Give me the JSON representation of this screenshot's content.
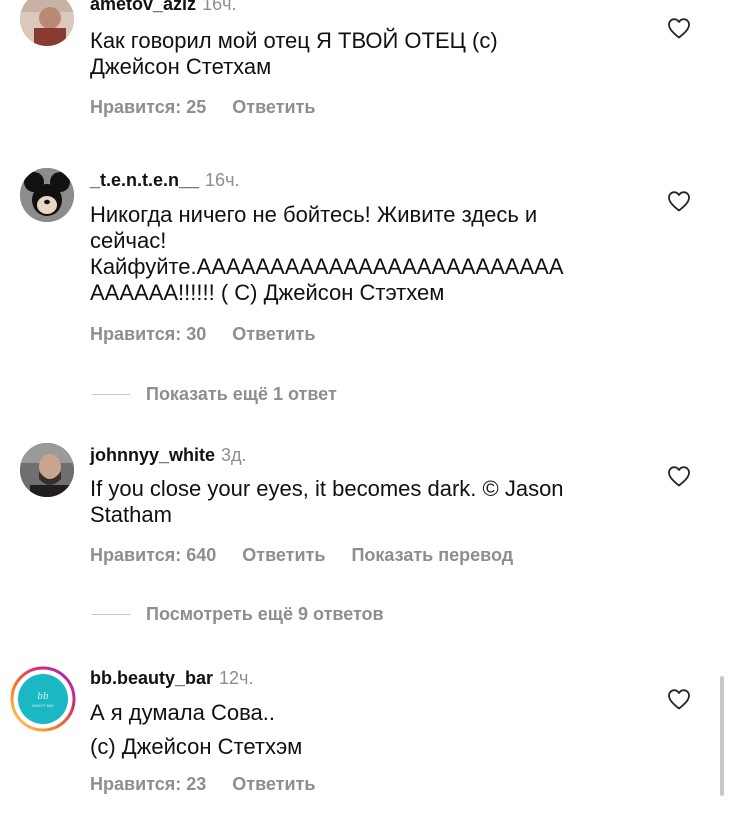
{
  "comments": [
    {
      "username": "ametov_aziz",
      "time": "16ч.",
      "lines": [
        "Как говорил мой отец Я ТВОЙ ОТЕЦ (с)",
        "Джейсон Стетхам"
      ],
      "likes_label": "Нравится: 25",
      "reply_label": "Ответить",
      "avatar_icon": "profile-photo"
    },
    {
      "username": "_t.e.n.t.e.n__",
      "time": "16ч.",
      "lines": [
        "Никогда ничего не бойтесь! Живите здесь и",
        "сейчас!",
        "Кайфуйте.ААААААААААААААААААААААААА",
        "АААААА!!!!!! ( С) Джейсон Стэтхем"
      ],
      "likes_label": "Нравится: 30",
      "reply_label": "Ответить",
      "avatar_icon": "mickey-mouse-avatar"
    },
    {
      "username": "johnnyy_white",
      "time": "3д.",
      "lines": [
        "If you close your eyes, it becomes dark. © Jason",
        "Statham"
      ],
      "likes_label": "Нравится: 640",
      "reply_label": "Ответить",
      "translate_label": "Показать перевод",
      "avatar_icon": "bearded-man-photo"
    },
    {
      "username": "bb.beauty_bar",
      "time": "12ч.",
      "lines": [
        "А я думала Сова..",
        "(с) Джейсон Стетхэм"
      ],
      "likes_label": "Нравится: 23",
      "reply_label": "Ответить",
      "avatar_icon": "beauty-bar-logo",
      "avatar_logo_text": "BEAUTY BAR"
    }
  ],
  "more_replies": [
    {
      "label": "Показать ещё 1 ответ"
    },
    {
      "label": "Посмотреть ещё 9 ответов"
    }
  ],
  "colors": {
    "text": "#111111",
    "muted": "#8e8e8e",
    "story_ring": [
      "#feda75",
      "#fa7e1e",
      "#d62976",
      "#962fbf"
    ],
    "logo_bg": "#19b8c2"
  }
}
